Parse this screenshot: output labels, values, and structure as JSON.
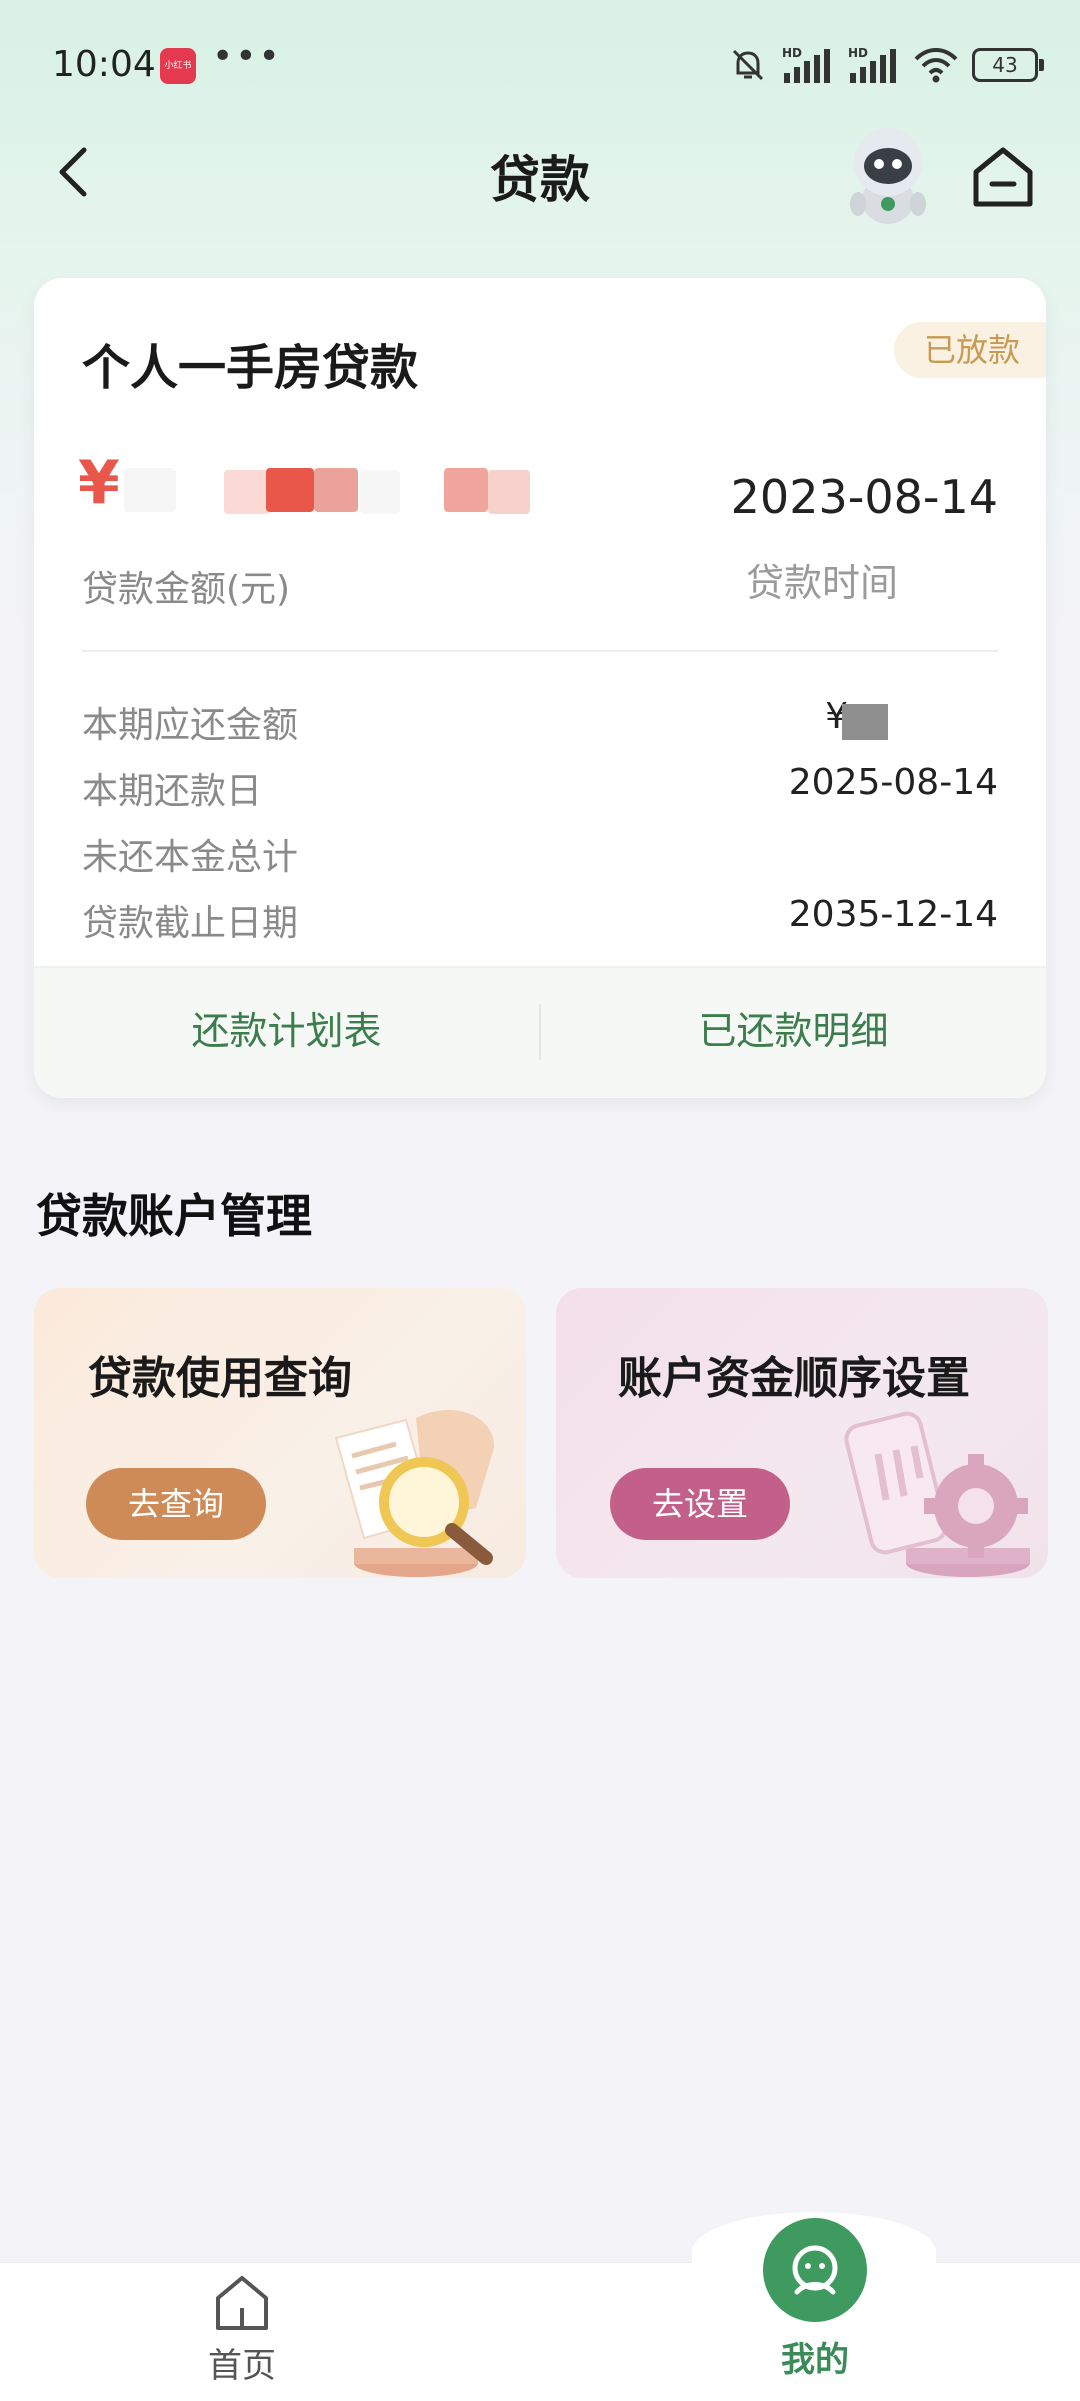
{
  "status_bar": {
    "time": "10:04",
    "app_badge": "小红书",
    "more": "•••",
    "battery": "43"
  },
  "nav": {
    "title": "贷款"
  },
  "loan": {
    "title": "个人一手房贷款",
    "status": "已放款",
    "amount_prefix": "¥",
    "amount_label": "贷款金额(元)",
    "date": "2023-08-14",
    "date_label": "贷款时间",
    "details": [
      {
        "label": "本期应还金额",
        "value": "¥"
      },
      {
        "label": "本期还款日",
        "value": "2025-08-14"
      },
      {
        "label": "未还本金总计",
        "value": ""
      },
      {
        "label": "贷款截止日期",
        "value": "2035-12-14"
      }
    ],
    "actions": {
      "schedule": "还款计划表",
      "history": "已还款明细"
    }
  },
  "management": {
    "title": "贷款账户管理",
    "cards": [
      {
        "title": "贷款使用查询",
        "button": "去查询",
        "color": "#cf8b57"
      },
      {
        "title": "账户资金顺序设置",
        "button": "去设置",
        "color": "#c3608a"
      }
    ]
  },
  "tabs": [
    {
      "label": "首页",
      "icon": "home-icon"
    },
    {
      "label": "我的",
      "icon": "user-icon",
      "active": true
    }
  ],
  "colors": {
    "accent_green": "#3e9a5f",
    "amount_red": "#e8574a",
    "tag_gold": "#c89b52"
  }
}
